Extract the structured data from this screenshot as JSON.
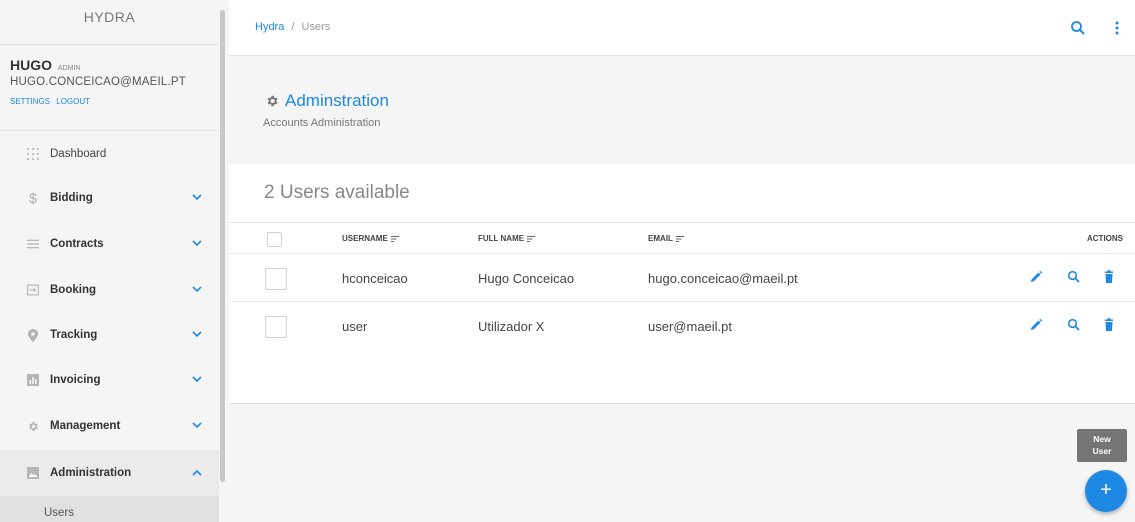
{
  "brand": "HYDRA",
  "user": {
    "name": "HUGO",
    "role": "ADMIN",
    "email": "HUGO.CONCEICAO@MAEIL.PT",
    "settings_label": "SETTINGS",
    "logout_label": "LOGOUT"
  },
  "nav": [
    {
      "label": "Dashboard",
      "icon": "dashboard-icon"
    },
    {
      "label": "Bidding",
      "icon": "dollar-icon",
      "expanded": false
    },
    {
      "label": "Contracts",
      "icon": "list-icon",
      "expanded": false
    },
    {
      "label": "Booking",
      "icon": "login-icon",
      "expanded": false
    },
    {
      "label": "Tracking",
      "icon": "location-pin-icon",
      "expanded": false
    },
    {
      "label": "Invoicing",
      "icon": "bar-chart-icon",
      "expanded": false
    },
    {
      "label": "Management",
      "icon": "gear-icon",
      "expanded": false
    },
    {
      "label": "Administration",
      "icon": "image-icon",
      "expanded": true
    }
  ],
  "nav_sub": {
    "label": "Users"
  },
  "breadcrumb": {
    "root": "Hydra",
    "separator": "/",
    "current": "Users"
  },
  "page": {
    "title": "Adminstration",
    "subtitle": "Accounts Administration"
  },
  "table": {
    "count_text": "2 Users available",
    "columns": [
      "USERNAME",
      "FULL NAME",
      "EMAIL",
      "ACTIONS"
    ],
    "rows": [
      {
        "username": "hconceicao",
        "full_name": "Hugo Conceicao",
        "email": "hugo.conceicao@maeil.pt"
      },
      {
        "username": "user",
        "full_name": "Utilizador X",
        "email": "user@maeil.pt"
      }
    ]
  },
  "fab": {
    "tooltip_line1": "New",
    "tooltip_line2": "User",
    "label": "+"
  },
  "colors": {
    "accent": "#1e88e5",
    "sidebar_bg": "#f5f5f5",
    "active_bg": "#ebebeb"
  }
}
